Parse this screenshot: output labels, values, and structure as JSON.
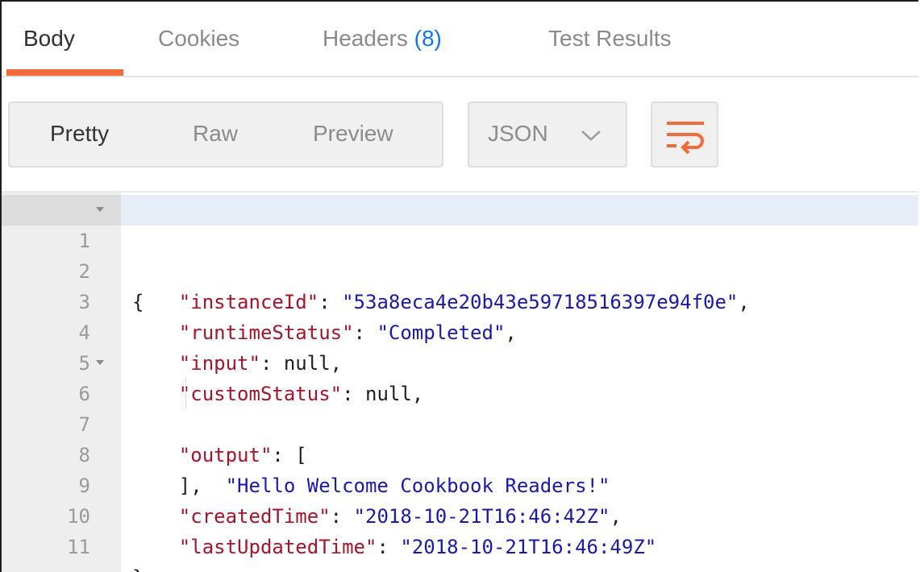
{
  "tabs": [
    {
      "label": "Body",
      "active": true
    },
    {
      "label": "Cookies",
      "active": false
    },
    {
      "label": "Headers",
      "count": "(8)",
      "active": false
    },
    {
      "label": "Test Results",
      "active": false
    }
  ],
  "toolbar": {
    "view_modes": [
      "Pretty",
      "Raw",
      "Preview"
    ],
    "active_view": "Pretty",
    "format": "JSON",
    "wrap_icon": "wrap-lines-icon"
  },
  "colors": {
    "accent": "#f26b3a",
    "count_blue": "#1a73e8",
    "json_key": "#a3152a",
    "json_string": "#1a1aa6"
  },
  "editor": {
    "lines": [
      {
        "num": "1",
        "text": "{"
      },
      {
        "num": "2",
        "key": "\"instanceId\"",
        "sep": ": ",
        "value": "\"53a8eca4e20b43e59718516397e94f0e\"",
        "end": ","
      },
      {
        "num": "3",
        "key": "\"runtimeStatus\"",
        "sep": ": ",
        "value": "\"Completed\"",
        "end": ","
      },
      {
        "num": "4",
        "key": "\"input\"",
        "sep": ": null",
        "end": ","
      },
      {
        "num": "5",
        "key": "\"customStatus\"",
        "sep": ": null",
        "end": ","
      },
      {
        "num": "6",
        "key": "\"output\"",
        "sep": ": ["
      },
      {
        "num": "7",
        "value": "\"Hello Welcome Cookbook Readers!\""
      },
      {
        "num": "8",
        "text": "],"
      },
      {
        "num": "9",
        "key": "\"createdTime\"",
        "sep": ": ",
        "value": "\"2018-10-21T16:46:42Z\"",
        "end": ","
      },
      {
        "num": "10",
        "key": "\"lastUpdatedTime\"",
        "sep": ": ",
        "value": "\"2018-10-21T16:46:49Z\""
      },
      {
        "num": "11",
        "text": "}"
      }
    ]
  }
}
